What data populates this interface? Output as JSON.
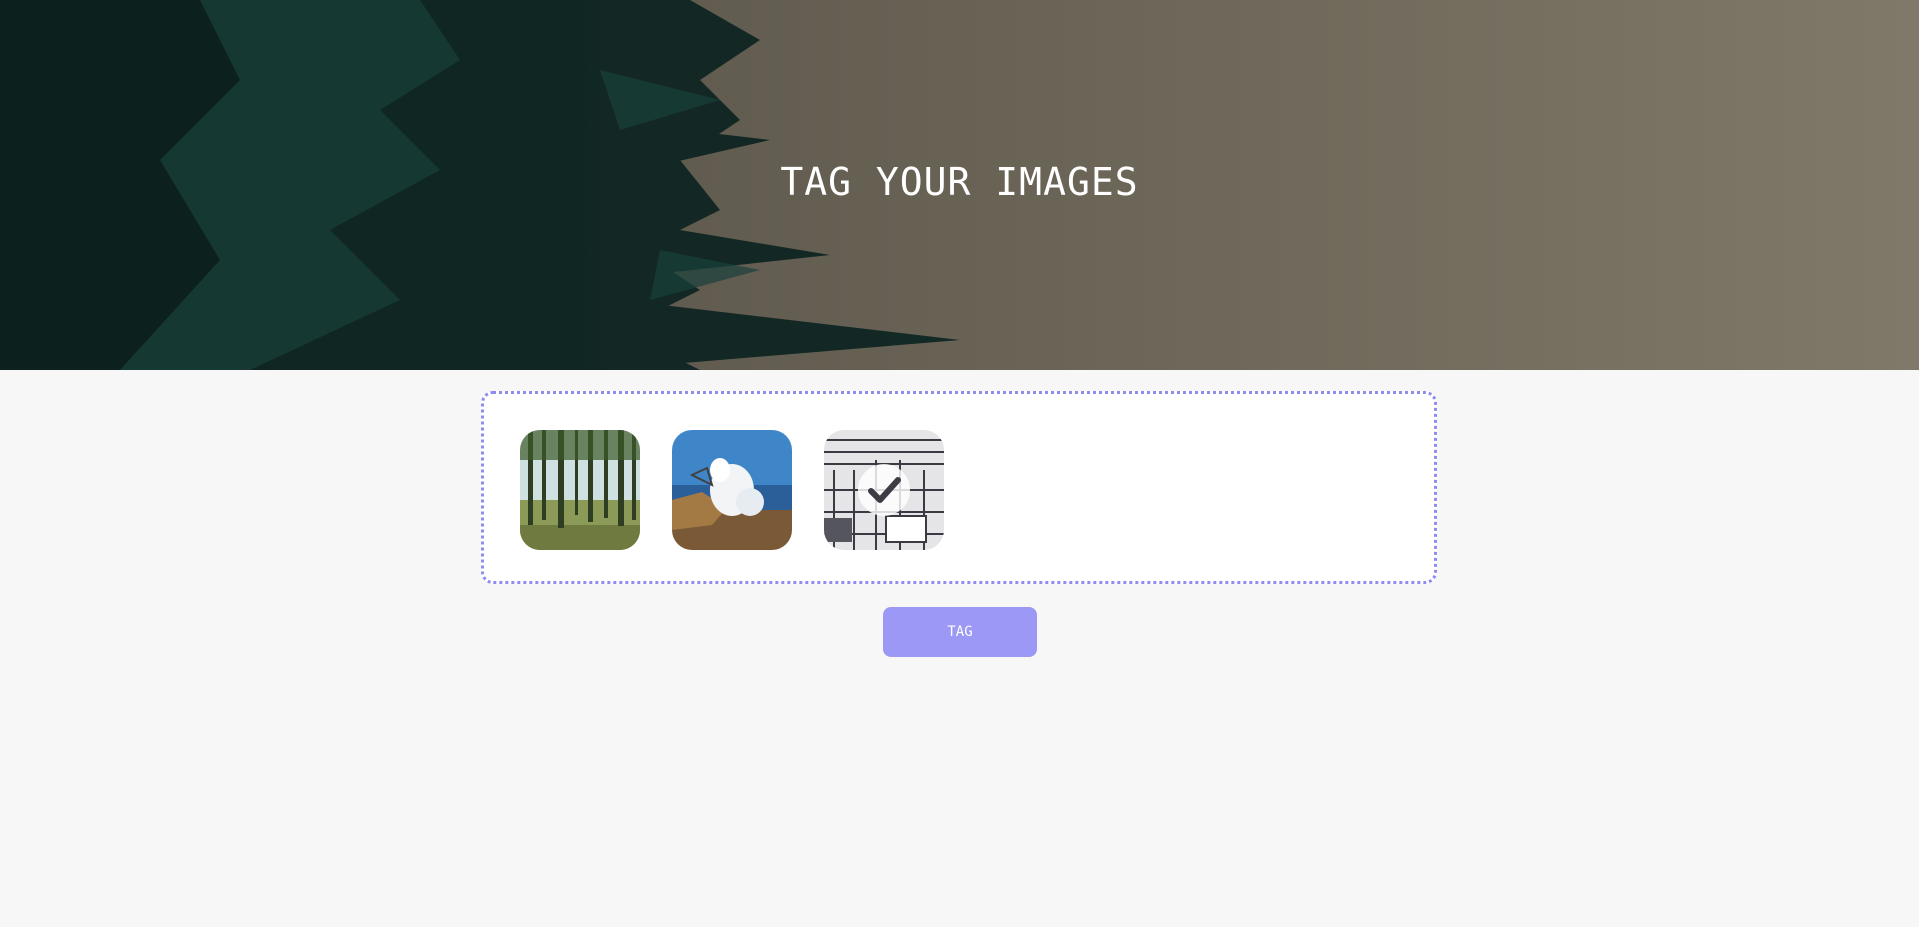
{
  "hero": {
    "title": "TAG YOUR IMAGES"
  },
  "dropzone": {
    "images": [
      {
        "name": "forest-image",
        "selected": false
      },
      {
        "name": "ocean-wave-image",
        "selected": false
      },
      {
        "name": "vintage-machine-image",
        "selected": true
      }
    ]
  },
  "actions": {
    "tag_label": "TAG"
  },
  "colors": {
    "accent": "#9b99f5",
    "dropzone_border": "#8f8cef",
    "page_background": "#f7f7f7"
  },
  "icons": {
    "selected": "check-icon"
  }
}
